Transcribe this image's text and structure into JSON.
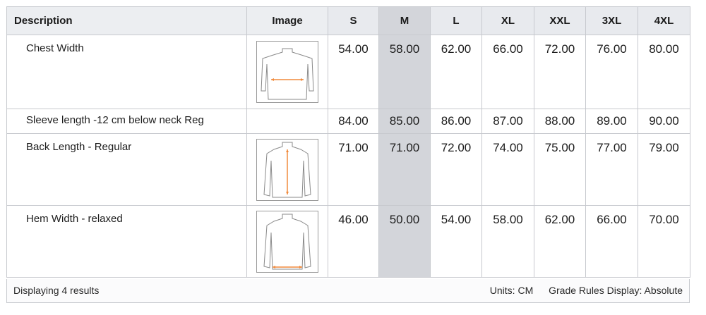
{
  "table": {
    "headers": {
      "description": "Description",
      "image": "Image",
      "sizes": [
        "S",
        "M",
        "L",
        "XL",
        "XXL",
        "3XL",
        "4XL"
      ]
    },
    "selected_size": "M",
    "rows": [
      {
        "description": "Chest Width",
        "image": "chest-width-diagram-icon",
        "values": [
          "54.00",
          "58.00",
          "62.00",
          "66.00",
          "72.00",
          "76.00",
          "80.00"
        ]
      },
      {
        "description": "Sleeve length -12 cm below neck Reg",
        "image": "",
        "values": [
          "84.00",
          "85.00",
          "86.00",
          "87.00",
          "88.00",
          "89.00",
          "90.00"
        ]
      },
      {
        "description": "Back Length - Regular",
        "image": "back-length-diagram-icon",
        "values": [
          "71.00",
          "71.00",
          "72.00",
          "74.00",
          "75.00",
          "77.00",
          "79.00"
        ]
      },
      {
        "description": "Hem Width - relaxed",
        "image": "hem-width-diagram-icon",
        "values": [
          "46.00",
          "50.00",
          "54.00",
          "58.00",
          "62.00",
          "66.00",
          "70.00"
        ]
      }
    ]
  },
  "footer": {
    "results": "Displaying 4 results",
    "units": "Units: CM",
    "grade_rules": "Grade Rules Display: Absolute"
  },
  "colors": {
    "border": "#c7c9ce",
    "header_bg": "#e8eaee",
    "selected_column": "#d3d5da",
    "measure_arrow": "#f08a3c"
  }
}
